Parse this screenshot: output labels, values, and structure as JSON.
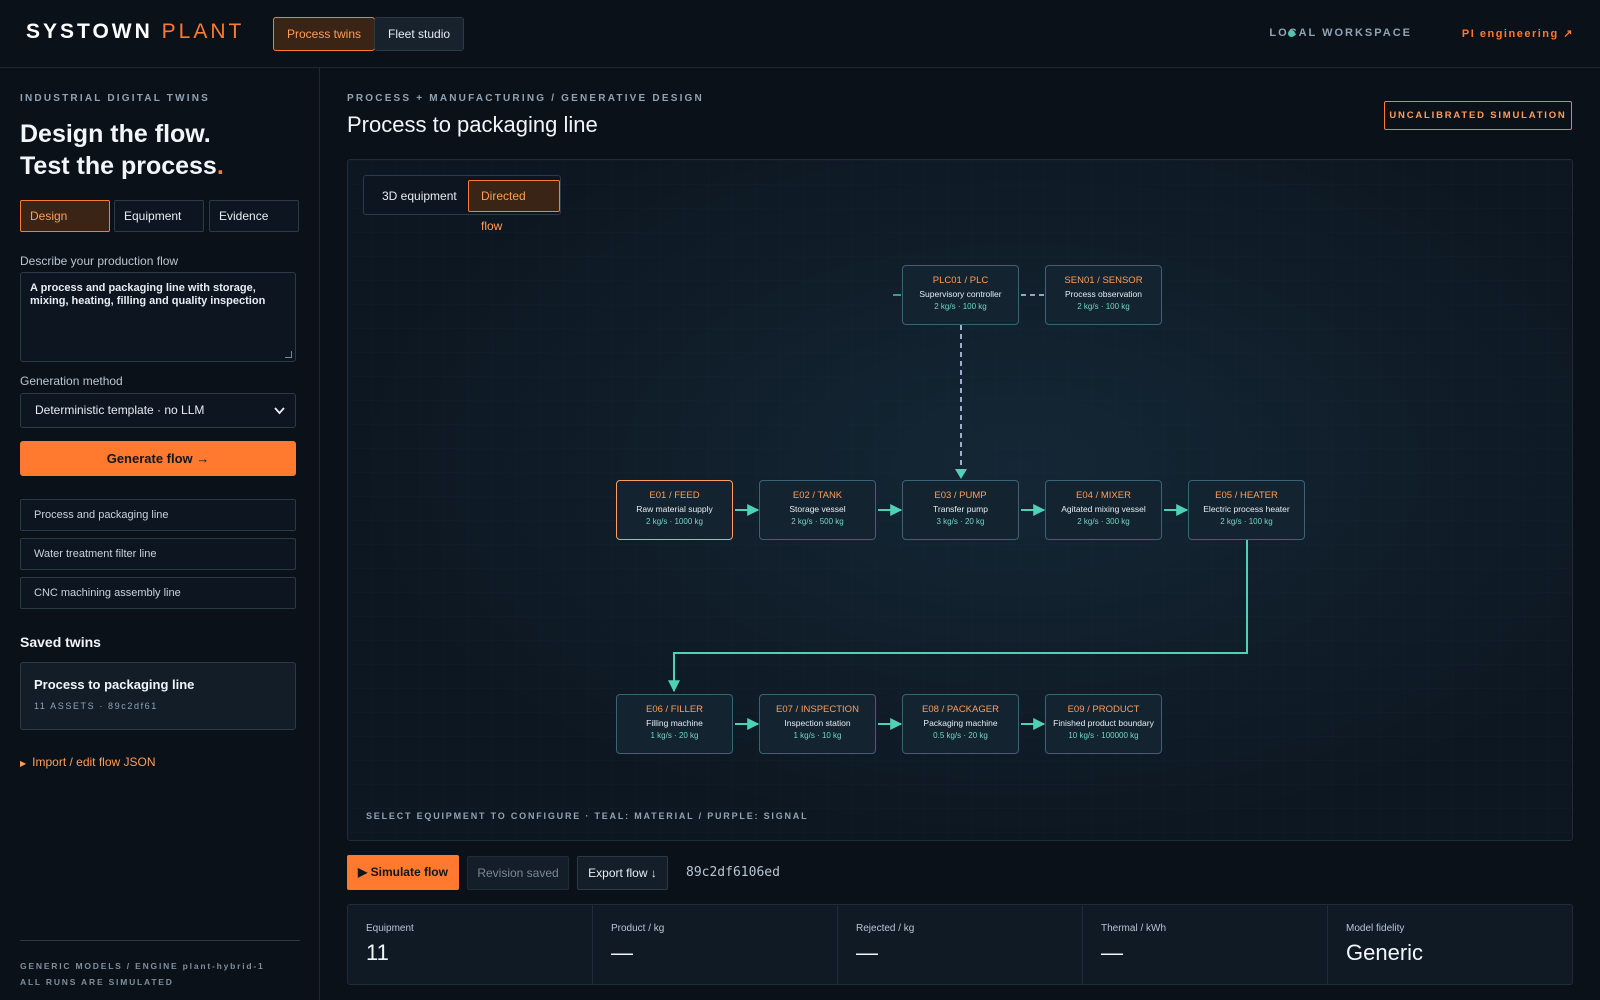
{
  "brand": {
    "name": "SYSTOWN",
    "suffix": "PLANT"
  },
  "top_tabs": [
    {
      "label": "Process twins",
      "active": true
    },
    {
      "label": "Fleet studio",
      "active": false
    }
  ],
  "workspace": {
    "label": "LOCAL WORKSPACE",
    "status_color": "#3fd1b2"
  },
  "pi_link": "PI engineering ↗",
  "sidebar": {
    "eyebrow": "INDUSTRIAL DIGITAL TWINS",
    "hero_line1": "Design the flow.",
    "hero_line2": "Test the process",
    "hero_dot": ".",
    "segments": [
      {
        "label": "Design",
        "active": true
      },
      {
        "label": "Equipment",
        "active": false
      },
      {
        "label": "Evidence",
        "active": false
      }
    ],
    "prompt_label": "Describe your production flow",
    "prompt_value": "A process and packaging line with storage, mixing, heating, filling and quality inspection",
    "method_label": "Generation method",
    "method_value": "Deterministic template · no LLM",
    "generate_label": "Generate flow →",
    "templates": [
      "Process and packaging line",
      "Water treatment filter line",
      "CNC machining assembly line"
    ],
    "saved_heading": "Saved twins",
    "saved": {
      "title": "Process to packaging line",
      "meta": "11 ASSETS · 89c2df61"
    },
    "import_label": "Import / edit flow JSON",
    "footer_line1": "GENERIC MODELS / ENGINE plant-hybrid-1",
    "footer_line2": "ALL RUNS ARE SIMULATED"
  },
  "main": {
    "eyebrow": "PROCESS + MANUFACTURING / GENERATIVE DESIGN",
    "title": "Process to packaging line",
    "badge": "UNCALIBRATED SIMULATION",
    "view_toggle": [
      {
        "label": "3D equipment",
        "active": false
      },
      {
        "label": "Directed flow",
        "active": true
      }
    ],
    "nodes": {
      "plc01": {
        "id": "PLC01 / PLC",
        "name": "Supervisory controller",
        "spec": "2 kg/s · 100 kg"
      },
      "sen01": {
        "id": "SEN01 / SENSOR",
        "name": "Process observation",
        "spec": "2 kg/s · 100 kg"
      },
      "e01": {
        "id": "E01 / FEED",
        "name": "Raw material supply",
        "spec": "2 kg/s · 1000 kg",
        "selected": true
      },
      "e02": {
        "id": "E02 / TANK",
        "name": "Storage vessel",
        "spec": "2 kg/s · 500 kg"
      },
      "e03": {
        "id": "E03 / PUMP",
        "name": "Transfer pump",
        "spec": "3 kg/s · 20 kg"
      },
      "e04": {
        "id": "E04 / MIXER",
        "name": "Agitated mixing vessel",
        "spec": "2 kg/s · 300 kg"
      },
      "e05": {
        "id": "E05 / HEATER",
        "name": "Electric process heater",
        "spec": "2 kg/s · 100 kg"
      },
      "e06": {
        "id": "E06 / FILLER",
        "name": "Filling machine",
        "spec": "1 kg/s · 20 kg"
      },
      "e07": {
        "id": "E07 / INSPECTION",
        "name": "Inspection station",
        "spec": "1 kg/s · 10 kg"
      },
      "e08": {
        "id": "E08 / PACKAGER",
        "name": "Packaging machine",
        "spec": "0.5 kg/s · 20 kg"
      },
      "e09": {
        "id": "E09 / PRODUCT",
        "name": "Finished product boundary",
        "spec": "10 kg/s · 100000 kg"
      }
    },
    "colors": {
      "material": "#4fd1b5",
      "signal": "#a9b4f0",
      "accent": "#ff7a2f"
    },
    "canvas_footer": "SELECT EQUIPMENT TO CONFIGURE · TEAL: MATERIAL / PURPLE: SIGNAL"
  },
  "actions": {
    "simulate": "Simulate flow",
    "revision": "Revision saved",
    "export": "Export flow ↓",
    "hash": "89c2df6106ed"
  },
  "metrics": [
    {
      "label": "Equipment",
      "value": "11"
    },
    {
      "label": "Product / kg",
      "value": "—"
    },
    {
      "label": "Rejected / kg",
      "value": "—"
    },
    {
      "label": "Thermal / kWh",
      "value": "—"
    },
    {
      "label": "Model fidelity",
      "value": "Generic"
    }
  ]
}
